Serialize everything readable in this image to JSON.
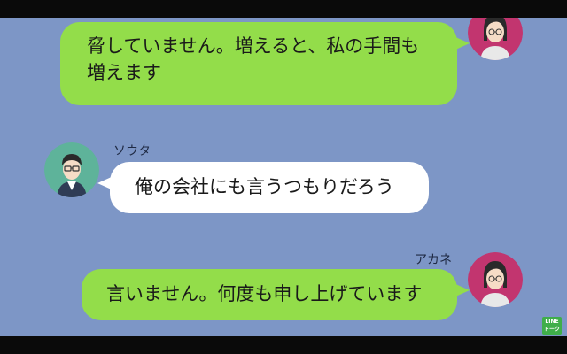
{
  "messages": [
    {
      "sender": "",
      "text_line1": "脅していません。増えると、私の手間も",
      "text_line2": "増えます",
      "side": "right",
      "color": "green"
    },
    {
      "sender": "ソウタ",
      "text": "俺の会社にも言うつもりだろう",
      "side": "left",
      "color": "white"
    },
    {
      "sender": "アカネ",
      "text": "言いません。何度も申し上げています",
      "side": "right",
      "color": "green"
    }
  ],
  "badge": {
    "line1": "LINE",
    "line2": "トーク"
  },
  "colors": {
    "background": "#7d96c6",
    "green_bubble": "#93dd4a",
    "white_bubble": "#ffffff",
    "avatar_female_bg": "#c2356f",
    "avatar_male_bg": "#5eb39a"
  }
}
